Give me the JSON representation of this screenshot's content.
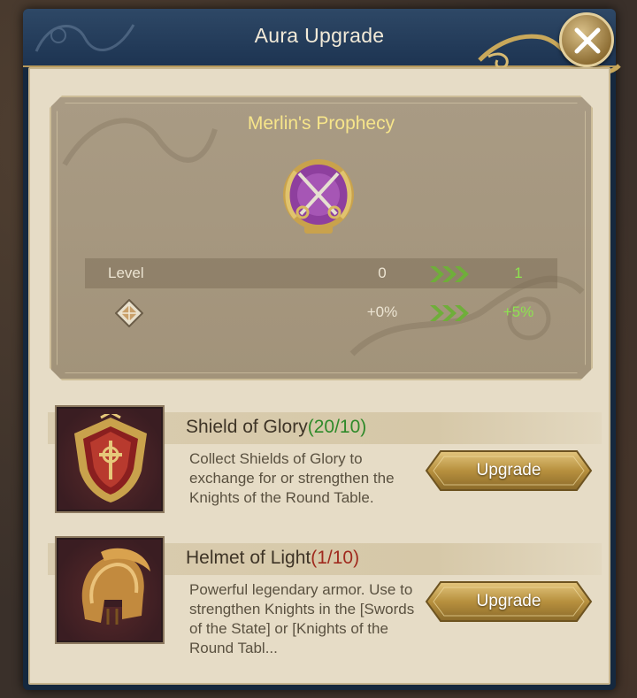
{
  "window": {
    "title": "Aura Upgrade"
  },
  "icons": {
    "close": "close-icon",
    "aura_emblem": "crossed-swords-emblem-icon",
    "stat_bonus": "diamond-stat-icon",
    "arrows": "triple-chevron-right-icon",
    "shield": "shield-of-glory-icon",
    "helmet": "helmet-of-light-icon"
  },
  "aura": {
    "name": "Merlin's Prophecy",
    "stats": [
      {
        "label": "Level",
        "current": "0",
        "next": "1"
      },
      {
        "label": "",
        "current": "+0%",
        "next": "+5%"
      }
    ]
  },
  "items": [
    {
      "name": "Shield of Glory",
      "count": "(20/10)",
      "count_status": "sufficient",
      "description": "Collect Shields of Glory to exchange for or strengthen the Knights of the Round Table.",
      "button_label": "Upgrade"
    },
    {
      "name": "Helmet of Light",
      "count": "(1/10)",
      "count_status": "insufficient",
      "description": "Powerful legendary armor. Use to strengthen Knights in the [Swords of the State] or [Knights of the Round Tabl...",
      "button_label": "Upgrade"
    }
  ],
  "colors": {
    "title_text": "#f2ead8",
    "aura_name": "#f7e58a",
    "next_value": "#8de34f",
    "count_sufficient": "#2f8a2a",
    "count_insufficient": "#a02a1e"
  }
}
